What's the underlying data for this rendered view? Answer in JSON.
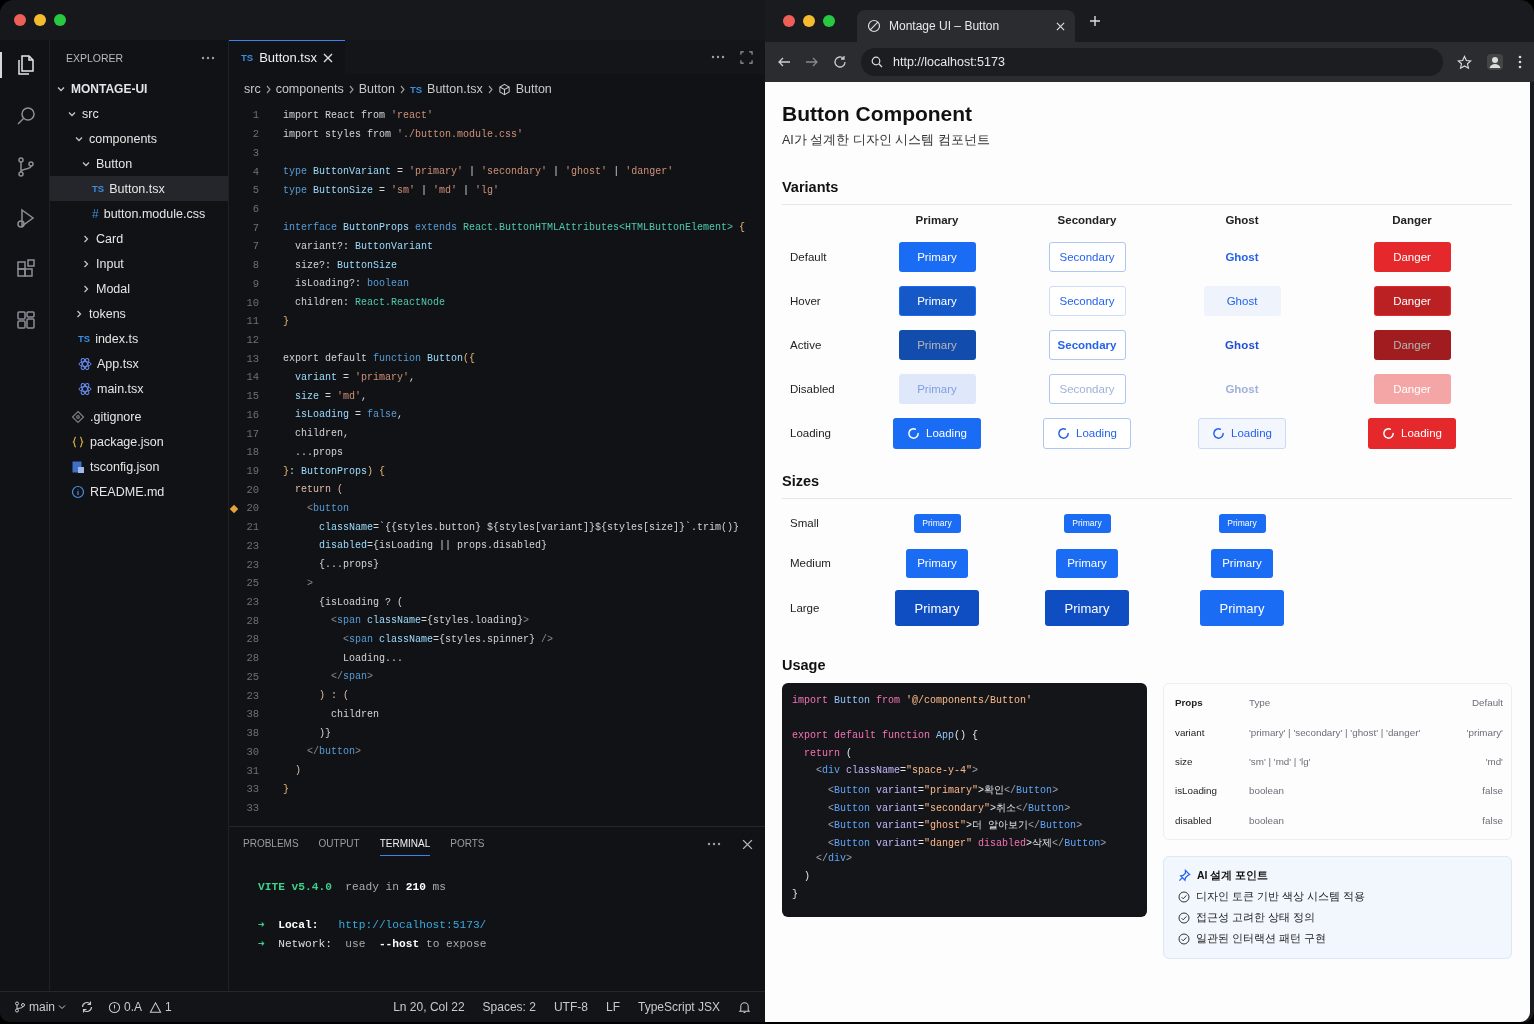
{
  "vscode": {
    "activity_bar": [
      {
        "kind": "files",
        "selected": true
      },
      {
        "kind": "search",
        "selected": false
      },
      {
        "kind": "source-control",
        "selected": false
      },
      {
        "kind": "run",
        "selected": false
      },
      {
        "kind": "extensions",
        "selected": false
      },
      {
        "kind": "blocks",
        "selected": false
      }
    ],
    "explorer": {
      "title": "EXPLORER",
      "tree": [
        {
          "name": "MONTAGE-UI",
          "kind": "folder",
          "expanded": true,
          "selected": false,
          "children": [
            {
              "name": "src",
              "kind": "folder",
              "expanded": true,
              "selected": false,
              "children": [
                {
                  "name": "components",
                  "kind": "folder",
                  "expanded": true,
                  "selected": false,
                  "children": [
                    {
                      "name": "Button",
                      "kind": "folder",
                      "expanded": true,
                      "selected": false,
                      "children": [
                        {
                          "name": "Button.tsx",
                          "kind": "ts",
                          "badge": "TS",
                          "selected": true
                        },
                        {
                          "name": "button.module.css",
                          "kind": "css",
                          "badge": "#",
                          "selected": false
                        }
                      ]
                    },
                    {
                      "name": "Card",
                      "kind": "folder",
                      "expanded": false,
                      "selected": false
                    },
                    {
                      "name": "Input",
                      "kind": "folder",
                      "expanded": false,
                      "selected": false
                    },
                    {
                      "name": "Modal",
                      "kind": "folder",
                      "expanded": false,
                      "selected": false
                    }
                  ]
                },
                {
                  "name": "tokens",
                  "kind": "folder",
                  "expanded": false,
                  "selected": false
                },
                {
                  "name": "index.ts",
                  "kind": "ts",
                  "badge": "TS",
                  "selected": false
                },
                {
                  "name": "App.tsx",
                  "kind": "react",
                  "selected": false
                },
                {
                  "name": "main.tsx",
                  "kind": "react",
                  "selected": false
                }
              ]
            },
            {
              "name": ".gitignore",
              "kind": "git",
              "selected": false
            },
            {
              "name": "package.json",
              "kind": "json",
              "selected": false
            },
            {
              "name": "tsconfig.json",
              "kind": "tsconfig",
              "selected": false
            },
            {
              "name": "README.md",
              "kind": "info",
              "selected": false
            }
          ]
        }
      ]
    },
    "editor_tabs": [
      {
        "badge": "TS",
        "label": "Button.tsx",
        "selected": true
      }
    ],
    "breadcrumbs": [
      {
        "kind": "plain",
        "text": "src"
      },
      {
        "kind": "plain",
        "text": "components"
      },
      {
        "kind": "plain",
        "text": "Button"
      },
      {
        "kind": "file",
        "badge": "TS",
        "text": "Button.tsx"
      },
      {
        "kind": "symbol",
        "text": "Button"
      }
    ],
    "code": [
      {
        "number": "1",
        "marker": false,
        "tokens": [
          {
            "kind": "plain",
            "text": "import React from "
          },
          {
            "kind": "str",
            "text": "'react'"
          }
        ]
      },
      {
        "number": "2",
        "marker": false,
        "tokens": [
          {
            "kind": "plain",
            "text": "import styles from "
          },
          {
            "kind": "str",
            "text": "'./button.module.css'"
          }
        ]
      },
      {
        "number": "3",
        "marker": false
      },
      {
        "number": "4",
        "marker": false,
        "tokens": [
          {
            "kind": "kw",
            "text": "type "
          },
          {
            "kind": "id",
            "text": "ButtonVariant"
          },
          {
            "kind": "plain",
            "text": " = "
          },
          {
            "kind": "str",
            "text": "'primary'"
          },
          {
            "kind": "plain",
            "text": " | "
          },
          {
            "kind": "str",
            "text": "'secondary'"
          },
          {
            "kind": "plain",
            "text": " | "
          },
          {
            "kind": "str",
            "text": "'ghost'"
          },
          {
            "kind": "plain",
            "text": " | "
          },
          {
            "kind": "str",
            "text": "'danger'"
          }
        ]
      },
      {
        "number": "5",
        "marker": false,
        "tokens": [
          {
            "kind": "kw",
            "text": "type "
          },
          {
            "kind": "id",
            "text": "ButtonSize"
          },
          {
            "kind": "plain",
            "text": " = "
          },
          {
            "kind": "str",
            "text": "'sm'"
          },
          {
            "kind": "plain",
            "text": " | "
          },
          {
            "kind": "str",
            "text": "'md'"
          },
          {
            "kind": "plain",
            "text": " | "
          },
          {
            "kind": "str",
            "text": "'lg'"
          }
        ]
      },
      {
        "number": "6",
        "marker": false
      },
      {
        "number": "7",
        "marker": false,
        "tokens": [
          {
            "kind": "kw",
            "text": "interface "
          },
          {
            "kind": "id",
            "text": "ButtonProps "
          },
          {
            "kind": "kw",
            "text": "extends "
          },
          {
            "kind": "type",
            "text": "React.ButtonHTMLAttributes<HTMLButtonElement>"
          },
          {
            "kind": "brace",
            "text": " {"
          }
        ]
      },
      {
        "number": "7",
        "marker": false,
        "tokens": [
          {
            "kind": "plain",
            "text": "  variant?: "
          },
          {
            "kind": "id",
            "text": "ButtonVariant"
          }
        ]
      },
      {
        "number": "8",
        "marker": false,
        "tokens": [
          {
            "kind": "plain",
            "text": "  size?: "
          },
          {
            "kind": "id",
            "text": "ButtonSize"
          }
        ]
      },
      {
        "number": "9",
        "marker": false,
        "tokens": [
          {
            "kind": "plain",
            "text": "  isLoading?: "
          },
          {
            "kind": "kw",
            "text": "boolean"
          }
        ]
      },
      {
        "number": "10",
        "marker": false,
        "tokens": [
          {
            "kind": "plain",
            "text": "  children: "
          },
          {
            "kind": "type",
            "text": "React.ReactNode"
          }
        ]
      },
      {
        "number": "11",
        "marker": false,
        "tokens": [
          {
            "kind": "brace",
            "text": "}"
          }
        ]
      },
      {
        "number": "12",
        "marker": false
      },
      {
        "number": "13",
        "marker": false,
        "tokens": [
          {
            "kind": "plain",
            "text": "export default "
          },
          {
            "kind": "kw",
            "text": "function "
          },
          {
            "kind": "id",
            "text": "Button"
          },
          {
            "kind": "brace",
            "text": "({"
          }
        ]
      },
      {
        "number": "14",
        "marker": false,
        "tokens": [
          {
            "kind": "id",
            "text": "  variant"
          },
          {
            "kind": "plain",
            "text": " = "
          },
          {
            "kind": "str",
            "text": "'primary'"
          },
          {
            "kind": "plain",
            "text": ","
          }
        ]
      },
      {
        "number": "15",
        "marker": false,
        "tokens": [
          {
            "kind": "id",
            "text": "  size"
          },
          {
            "kind": "plain",
            "text": " = "
          },
          {
            "kind": "str",
            "text": "'md'"
          },
          {
            "kind": "plain",
            "text": ","
          }
        ]
      },
      {
        "number": "16",
        "marker": false,
        "tokens": [
          {
            "kind": "id",
            "text": "  isLoading"
          },
          {
            "kind": "plain",
            "text": " = "
          },
          {
            "kind": "kw",
            "text": "false"
          },
          {
            "kind": "plain",
            "text": ","
          }
        ]
      },
      {
        "number": "17",
        "marker": false,
        "tokens": [
          {
            "kind": "plain",
            "text": "  children,"
          }
        ]
      },
      {
        "number": "18",
        "marker": false,
        "tokens": [
          {
            "kind": "plain",
            "text": "  ...props"
          }
        ]
      },
      {
        "number": "19",
        "marker": false,
        "tokens": [
          {
            "kind": "brace",
            "text": "}"
          },
          {
            "kind": "plain",
            "text": ": "
          },
          {
            "kind": "id",
            "text": "ButtonProps"
          },
          {
            "kind": "brace",
            "text": ") {"
          }
        ]
      },
      {
        "number": "20",
        "marker": false,
        "tokens": [
          {
            "kind": "ctrl",
            "text": "  return ("
          }
        ]
      },
      {
        "number": "20",
        "marker": true,
        "tokens": [
          {
            "kind": "punct",
            "text": "    <"
          },
          {
            "kind": "tag",
            "text": "button"
          }
        ]
      },
      {
        "number": "21",
        "marker": false,
        "tokens": [
          {
            "kind": "attr",
            "text": "      className"
          },
          {
            "kind": "plain",
            "text": "=`{{styles.button} ${styles[variant]}${styles[size]}`.trim()}"
          }
        ]
      },
      {
        "number": "23",
        "marker": false,
        "tokens": [
          {
            "kind": "attr",
            "text": "      disabled"
          },
          {
            "kind": "plain",
            "text": "={isLoading || props.disabled}"
          }
        ]
      },
      {
        "number": "23",
        "marker": false,
        "tokens": [
          {
            "kind": "plain",
            "text": "      {...props}"
          }
        ]
      },
      {
        "number": "25",
        "marker": false,
        "tokens": [
          {
            "kind": "punct",
            "text": "    >"
          }
        ]
      },
      {
        "number": "23",
        "marker": false,
        "tokens": [
          {
            "kind": "plain",
            "text": "      {isLoading ? ("
          }
        ]
      },
      {
        "number": "28",
        "marker": false,
        "tokens": [
          {
            "kind": "punct",
            "text": "        <"
          },
          {
            "kind": "tag",
            "text": "span "
          },
          {
            "kind": "attr",
            "text": "className"
          },
          {
            "kind": "plain",
            "text": "={styles.loading}"
          },
          {
            "kind": "punct",
            "text": ">"
          }
        ]
      },
      {
        "number": "28",
        "marker": false,
        "tokens": [
          {
            "kind": "punct",
            "text": "          <"
          },
          {
            "kind": "tag",
            "text": "span "
          },
          {
            "kind": "attr",
            "text": "className"
          },
          {
            "kind": "plain",
            "text": "={styles.spinner} "
          },
          {
            "kind": "punct",
            "text": "/>"
          }
        ]
      },
      {
        "number": "28",
        "marker": false,
        "tokens": [
          {
            "kind": "plain",
            "text": "          Loading..."
          }
        ]
      },
      {
        "number": "25",
        "marker": false,
        "tokens": [
          {
            "kind": "punct",
            "text": "        </"
          },
          {
            "kind": "tag",
            "text": "span"
          },
          {
            "kind": "punct",
            "text": ">"
          }
        ]
      },
      {
        "number": "23",
        "marker": false,
        "tokens": [
          {
            "kind": "ctrl",
            "text": "      ) : ("
          }
        ]
      },
      {
        "number": "38",
        "marker": false,
        "tokens": [
          {
            "kind": "plain",
            "text": "        children"
          }
        ]
      },
      {
        "number": "38",
        "marker": false,
        "tokens": [
          {
            "kind": "plain",
            "text": "      )}"
          }
        ]
      },
      {
        "number": "30",
        "marker": false,
        "tokens": [
          {
            "kind": "punct",
            "text": "    </"
          },
          {
            "kind": "tag",
            "text": "button"
          },
          {
            "kind": "punct",
            "text": ">"
          }
        ]
      },
      {
        "number": "31",
        "marker": false,
        "tokens": [
          {
            "kind": "ctrl",
            "text": "  )"
          }
        ]
      },
      {
        "number": "33",
        "marker": false,
        "tokens": [
          {
            "kind": "brace",
            "text": "}"
          }
        ]
      },
      {
        "number": "33",
        "marker": false
      }
    ],
    "panel_tabs": [
      {
        "label": "PROBLEMS",
        "selected": false
      },
      {
        "label": "OUTPUT",
        "selected": false
      },
      {
        "label": "TERMINAL",
        "selected": true
      },
      {
        "label": "PORTS",
        "selected": false
      }
    ],
    "terminal": [
      {
        "kind": "text",
        "segments": [
          {
            "kind": "accent",
            "text": "VITE v5.4.0"
          },
          {
            "kind": "muted",
            "text": "  ready in "
          },
          {
            "kind": "strong",
            "text": "210"
          },
          {
            "kind": "muted",
            "text": " ms"
          }
        ]
      },
      {
        "kind": "blank"
      },
      {
        "kind": "text",
        "segments": [
          {
            "kind": "accent",
            "text": "➜"
          },
          {
            "kind": "strong",
            "text": "  Local:   "
          },
          {
            "kind": "link",
            "text": "http://localhost:5173/"
          }
        ]
      },
      {
        "kind": "text",
        "segments": [
          {
            "kind": "accent",
            "text": "➜"
          },
          {
            "kind": "label",
            "text": "  Network:  "
          },
          {
            "kind": "muted",
            "text": "use  "
          },
          {
            "kind": "strong",
            "text": "--host"
          },
          {
            "kind": "muted",
            "text": " to expose"
          }
        ]
      }
    ],
    "status_bar": {
      "branch": "main",
      "errors": "0.A",
      "warnings": "1",
      "items": [
        "Ln 20, Col 22",
        "Spaces: 2",
        "UTF-8",
        "LF",
        "TypeScript JSX"
      ]
    }
  },
  "browser": {
    "tab": {
      "title": "Montage UI – Button"
    },
    "url": "http://localhost:5173",
    "page": {
      "title": "Button Component",
      "subtitle": "AI가 설계한 디자인 시스템 컴포넌트",
      "variants": {
        "heading": "Variants",
        "columns": [
          "Primary",
          "Secondary",
          "Ghost",
          "Danger"
        ],
        "rows": [
          {
            "label": "Default",
            "buttons": [
              {
                "kind": "primary",
                "text": "Primary",
                "hovered": false,
                "pressed": false,
                "disabled": false,
                "loading": false
              },
              {
                "kind": "secondary",
                "text": "Secondary",
                "hovered": false,
                "pressed": false,
                "disabled": false,
                "loading": false
              },
              {
                "kind": "ghost",
                "text": "Ghost",
                "hovered": false,
                "pressed": false,
                "disabled": false,
                "loading": false
              },
              {
                "kind": "danger",
                "text": "Danger",
                "hovered": false,
                "pressed": false,
                "disabled": false,
                "loading": false
              }
            ]
          },
          {
            "label": "Hover",
            "buttons": [
              {
                "kind": "primary",
                "text": "Primary",
                "hovered": true,
                "pressed": false,
                "disabled": false,
                "loading": false
              },
              {
                "kind": "secondary",
                "text": "Secondary",
                "hovered": true,
                "pressed": false,
                "disabled": false,
                "loading": false
              },
              {
                "kind": "ghost",
                "text": "Ghost",
                "hovered": true,
                "pressed": false,
                "disabled": false,
                "loading": false
              },
              {
                "kind": "danger",
                "text": "Danger",
                "hovered": true,
                "pressed": false,
                "disabled": false,
                "loading": false
              }
            ]
          },
          {
            "label": "Active",
            "buttons": [
              {
                "kind": "primary",
                "text": "Primary",
                "hovered": false,
                "pressed": true,
                "disabled": false,
                "loading": false
              },
              {
                "kind": "secondary",
                "text": "Secondary",
                "hovered": false,
                "pressed": true,
                "disabled": false,
                "loading": false
              },
              {
                "kind": "ghost",
                "text": "Ghost",
                "hovered": false,
                "pressed": true,
                "disabled": false,
                "loading": false
              },
              {
                "kind": "danger",
                "text": "Danger",
                "hovered": false,
                "pressed": true,
                "disabled": false,
                "loading": false
              }
            ]
          },
          {
            "label": "Disabled",
            "buttons": [
              {
                "kind": "primary",
                "text": "Primary",
                "hovered": false,
                "pressed": false,
                "disabled": true,
                "loading": false
              },
              {
                "kind": "secondary",
                "text": "Secondary",
                "hovered": false,
                "pressed": false,
                "disabled": true,
                "loading": false
              },
              {
                "kind": "ghost",
                "text": "Ghost",
                "hovered": false,
                "pressed": false,
                "disabled": true,
                "loading": false
              },
              {
                "kind": "danger",
                "text": "Danger",
                "hovered": false,
                "pressed": false,
                "disabled": true,
                "loading": false
              }
            ]
          },
          {
            "label": "Loading",
            "buttons": [
              {
                "kind": "primary",
                "text": "Loading",
                "hovered": false,
                "pressed": false,
                "disabled": false,
                "loading": true
              },
              {
                "kind": "secondary",
                "text": "Loading",
                "hovered": false,
                "pressed": false,
                "disabled": false,
                "loading": true
              },
              {
                "kind": "ghost",
                "text": "Loading",
                "hovered": false,
                "pressed": false,
                "disabled": false,
                "loading": true
              },
              {
                "kind": "danger",
                "text": "Loading",
                "hovered": false,
                "pressed": false,
                "disabled": false,
                "loading": true
              }
            ]
          }
        ]
      },
      "sizes": {
        "heading": "Sizes",
        "rows": [
          {
            "label": "Small",
            "buttons": [
              {
                "kind": "sm",
                "text": "Primary",
                "hovered": false
              },
              {
                "kind": "sm",
                "text": "Primary",
                "hovered": false
              },
              {
                "kind": "sm",
                "text": "Primary",
                "hovered": false
              }
            ]
          },
          {
            "label": "Medium",
            "buttons": [
              {
                "kind": "md",
                "text": "Primary",
                "hovered": false
              },
              {
                "kind": "md",
                "text": "Primary",
                "hovered": false
              },
              {
                "kind": "md",
                "text": "Primary",
                "hovered": false
              }
            ]
          },
          {
            "label": "Large",
            "buttons": [
              {
                "kind": "lg",
                "text": "Primary",
                "hovered": true
              },
              {
                "kind": "lg",
                "text": "Primary",
                "hovered": true
              },
              {
                "kind": "lg",
                "text": "Primary",
                "hovered": false
              }
            ]
          }
        ]
      },
      "usage": {
        "heading": "Usage",
        "code_blocks": [
          {
            "lines": [
              {
                "tokens": [
                  {
                    "kind": "kw",
                    "text": "import "
                  },
                  {
                    "kind": "id",
                    "text": "Button "
                  },
                  {
                    "kind": "kw",
                    "text": "from "
                  },
                  {
                    "kind": "str",
                    "text": "'@/components/Button'"
                  }
                ]
              }
            ]
          },
          {
            "lines": [
              {
                "tokens": [
                  {
                    "kind": "kw",
                    "text": "export default function "
                  },
                  {
                    "kind": "id",
                    "text": "App"
                  },
                  {
                    "kind": "plain",
                    "text": "() {"
                  }
                ]
              },
              {
                "tokens": [
                  {
                    "kind": "kw",
                    "text": "  return"
                  },
                  {
                    "kind": "plain",
                    "text": " ("
                  }
                ]
              },
              {
                "tokens": [
                  {
                    "kind": "punct",
                    "text": "    <"
                  },
                  {
                    "kind": "tag",
                    "text": "div "
                  },
                  {
                    "kind": "attr",
                    "text": "className"
                  },
                  {
                    "kind": "plain",
                    "text": "="
                  },
                  {
                    "kind": "str",
                    "text": "\"space-y-4\""
                  },
                  {
                    "kind": "punct",
                    "text": ">"
                  }
                ]
              },
              {
                "tokens": [
                  {
                    "kind": "punct",
                    "text": "      <"
                  },
                  {
                    "kind": "tag",
                    "text": "Button "
                  },
                  {
                    "kind": "attr",
                    "text": "variant"
                  },
                  {
                    "kind": "plain",
                    "text": "="
                  },
                  {
                    "kind": "str",
                    "text": "\"primary\""
                  },
                  {
                    "kind": "plain",
                    "text": ">확인"
                  },
                  {
                    "kind": "punct",
                    "text": "</"
                  },
                  {
                    "kind": "tag",
                    "text": "Button"
                  },
                  {
                    "kind": "punct",
                    "text": ">"
                  }
                ]
              },
              {
                "tokens": [
                  {
                    "kind": "punct",
                    "text": "      <"
                  },
                  {
                    "kind": "tag",
                    "text": "Button "
                  },
                  {
                    "kind": "attr",
                    "text": "variant"
                  },
                  {
                    "kind": "plain",
                    "text": "="
                  },
                  {
                    "kind": "str",
                    "text": "\"secondary\""
                  },
                  {
                    "kind": "plain",
                    "text": ">취소"
                  },
                  {
                    "kind": "punct",
                    "text": "</"
                  },
                  {
                    "kind": "tag",
                    "text": "Button"
                  },
                  {
                    "kind": "punct",
                    "text": ">"
                  }
                ]
              },
              {
                "tokens": [
                  {
                    "kind": "punct",
                    "text": "      <"
                  },
                  {
                    "kind": "tag",
                    "text": "Button "
                  },
                  {
                    "kind": "attr",
                    "text": "variant"
                  },
                  {
                    "kind": "plain",
                    "text": "="
                  },
                  {
                    "kind": "str",
                    "text": "\"ghost\""
                  },
                  {
                    "kind": "plain",
                    "text": ">더 알아보기"
                  },
                  {
                    "kind": "punct",
                    "text": "</"
                  },
                  {
                    "kind": "tag",
                    "text": "Button"
                  },
                  {
                    "kind": "punct",
                    "text": ">"
                  }
                ]
              },
              {
                "tokens": [
                  {
                    "kind": "punct",
                    "text": "      <"
                  },
                  {
                    "kind": "tag",
                    "text": "Button "
                  },
                  {
                    "kind": "attr",
                    "text": "variant"
                  },
                  {
                    "kind": "plain",
                    "text": "="
                  },
                  {
                    "kind": "str",
                    "text": "\"danger\" "
                  },
                  {
                    "kind": "kw",
                    "text": "disabled"
                  },
                  {
                    "kind": "plain",
                    "text": ">삭제"
                  },
                  {
                    "kind": "punct",
                    "text": "</"
                  },
                  {
                    "kind": "tag",
                    "text": "Button"
                  },
                  {
                    "kind": "punct",
                    "text": ">"
                  }
                ]
              },
              {
                "tokens": [
                  {
                    "kind": "punct",
                    "text": "    </"
                  },
                  {
                    "kind": "tag",
                    "text": "div"
                  },
                  {
                    "kind": "punct",
                    "text": ">"
                  }
                ]
              },
              {
                "tokens": [
                  {
                    "kind": "plain",
                    "text": "  )"
                  }
                ]
              },
              {
                "tokens": [
                  {
                    "kind": "plain",
                    "text": "}"
                  }
                ]
              }
            ]
          }
        ],
        "props_table": {
          "columns": [
            "Props",
            "Type",
            "Default"
          ],
          "rows": [
            [
              "variant",
              "'primary' | 'secondary' | 'ghost' | 'danger'",
              "'primary'"
            ],
            [
              "size",
              "'sm' | 'md' | 'lg'",
              "'md'"
            ],
            [
              "isLoading",
              "boolean",
              "false"
            ],
            [
              "disabled",
              "boolean",
              "false"
            ]
          ]
        },
        "notes": {
          "title": "AI 설계 포인트",
          "items": [
            "디자인 토큰 기반 색상 시스템 적용",
            "접근성 고려한 상태 정의",
            "일관된 인터랙션 패턴 구현"
          ]
        }
      }
    }
  }
}
